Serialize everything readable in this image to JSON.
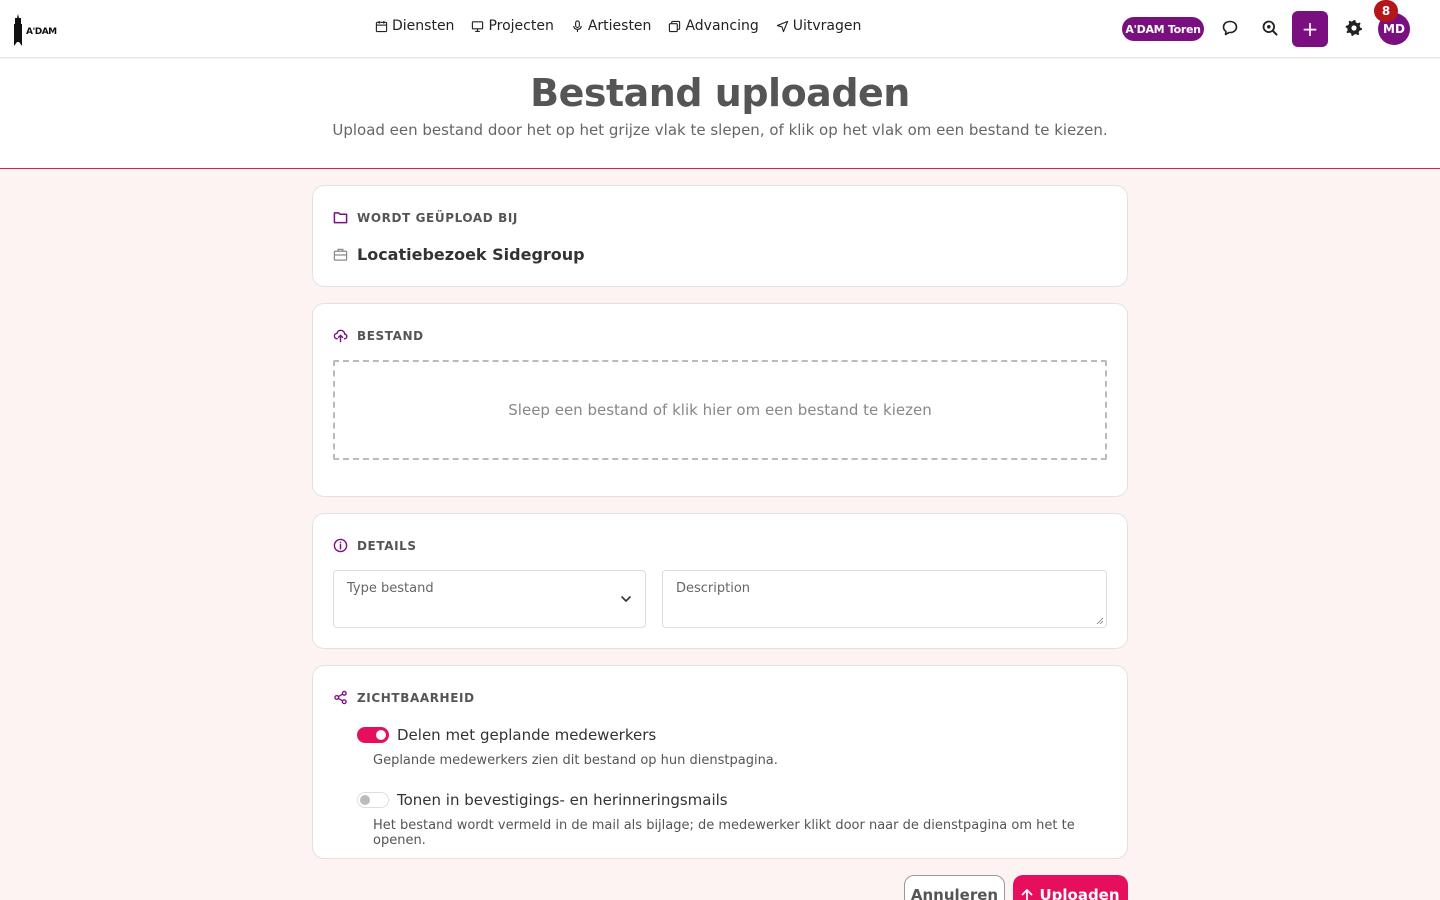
{
  "logo": {
    "text": "A'DAM"
  },
  "nav": [
    {
      "label": "Diensten",
      "icon": "calendar-icon"
    },
    {
      "label": "Projecten",
      "icon": "monitor-icon"
    },
    {
      "label": "Artiesten",
      "icon": "microphone-icon"
    },
    {
      "label": "Advancing",
      "icon": "copy-icon"
    },
    {
      "label": "Uitvragen",
      "icon": "send-icon"
    }
  ],
  "header_right": {
    "location": "A'DAM Toren",
    "avatar_initials": "MD",
    "notification_count": "8",
    "add_label": "+"
  },
  "page": {
    "title": "Bestand uploaden",
    "subtitle": "Upload een bestand door het op het grijze vlak te slepen, of klik op het vlak om een bestand te kiezen."
  },
  "uploaded_to": {
    "label": "WORDT GEÜPLOAD BIJ",
    "name": "Locatiebezoek Sidegroup"
  },
  "file": {
    "label": "BESTAND",
    "dropzone_text": "Sleep een bestand of klik hier om een bestand te kiezen"
  },
  "details": {
    "label": "DETAILS",
    "type_placeholder": "Type bestand",
    "description_placeholder": "Description"
  },
  "visibility": {
    "label": "ZICHTBAARHEID",
    "share_label": "Delen met geplande medewerkers",
    "share_help": "Geplande medewerkers zien dit bestand op hun dienstpagina.",
    "share_on": true,
    "mail_label": "Tonen in bevestigings- en herinneringsmails",
    "mail_help": "Het bestand wordt vermeld in de mail als bijlage; de medewerker klikt door naar de dienstpagina om het te openen.",
    "mail_on": false
  },
  "actions": {
    "cancel": "Annuleren",
    "upload": "Uploaden"
  },
  "colors": {
    "brand_purple": "#7a0f7f",
    "accent_pink": "#e50f5d",
    "badge_red": "#b5161b"
  }
}
